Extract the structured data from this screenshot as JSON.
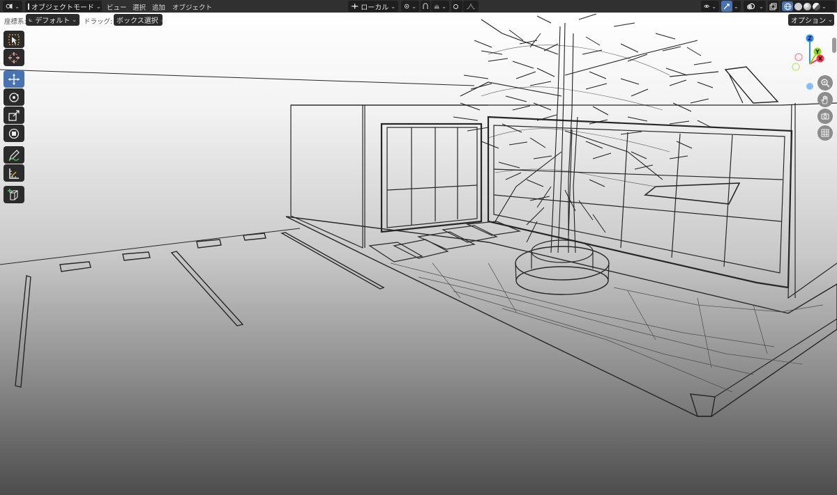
{
  "header": {
    "mode_label": "オブジェクトモード",
    "menu": [
      "ビュー",
      "選択",
      "追加",
      "オブジェクト"
    ],
    "transform_orientation": "ローカル"
  },
  "tool_header": {
    "coord_label": "座標系:",
    "coord_value": "デフォルト",
    "drag_label": "ドラッグ:",
    "drag_value": "ボックス選択",
    "options_label": "オプション"
  },
  "toolbar": {
    "tools": [
      "select-box",
      "cursor",
      "move",
      "rotate",
      "scale",
      "transform",
      "annotate",
      "measure",
      "add-cube"
    ],
    "active": "move"
  },
  "gizmo": {
    "axes": [
      "Z",
      "Y",
      "X"
    ]
  },
  "colors": {
    "header_bg": "#303030",
    "active_blue": "#4772b3",
    "axis_x": "#ff3352",
    "axis_y": "#8bdc00",
    "axis_z": "#2890ff"
  }
}
